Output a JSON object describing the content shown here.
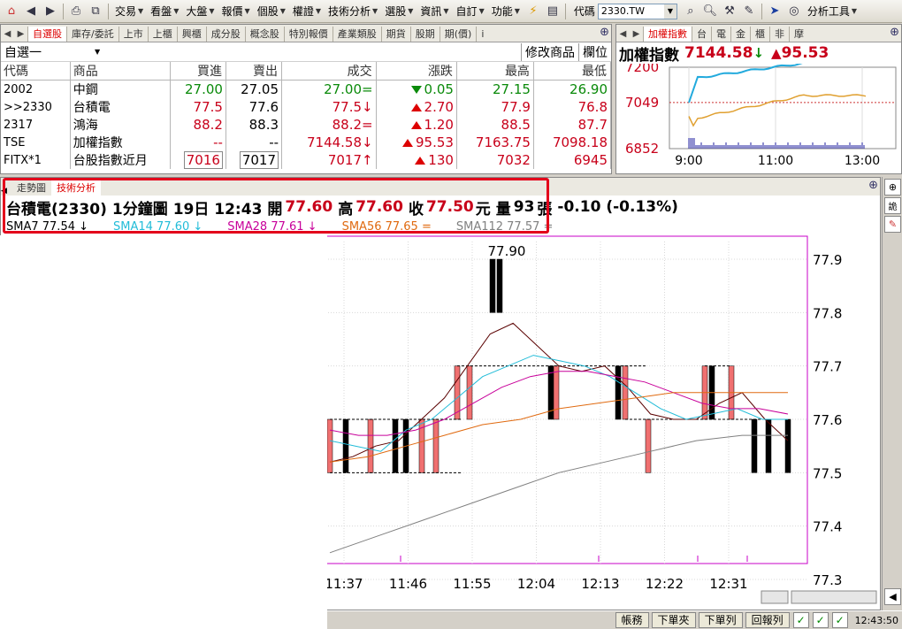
{
  "toolbar": {
    "menus": [
      "交易",
      "看盤",
      "大盤",
      "報價",
      "個股",
      "權證",
      "技術分析",
      "選股",
      "資訊",
      "自訂",
      "功能"
    ],
    "code_label": "代碼",
    "code_value": "2330.TW",
    "tools_label": "分析工具"
  },
  "quote_panel": {
    "tabs": [
      "自選股",
      "庫存/委託",
      "上市",
      "上櫃",
      "興櫃",
      "成分股",
      "概念股",
      "特別報價",
      "產業類股",
      "期貨",
      "股期",
      "期(價)",
      "i"
    ],
    "active_tab": 0,
    "list_name": "自選一",
    "edit_label": "修改商品",
    "columns_label": "欄位",
    "headers": [
      "代碼",
      "商品",
      "買進",
      "賣出",
      "成交",
      "漲跌",
      "最高",
      "最低"
    ],
    "rows": [
      {
        "code": "2002",
        "name": "中鋼",
        "bid": "27.00",
        "ask": "27.05",
        "last": "27.00=",
        "change": "0.05",
        "dir": "down",
        "high": "27.15",
        "low": "26.90",
        "color": "green"
      },
      {
        "code": ">>2330",
        "name": "台積電",
        "bid": "77.5",
        "ask": "77.6",
        "last": "77.5↓",
        "change": "2.70",
        "dir": "up",
        "high": "77.9",
        "low": "76.8",
        "color": "red"
      },
      {
        "code": "2317",
        "name": "鴻海",
        "bid": "88.2",
        "ask": "88.3",
        "last": "88.2=",
        "change": "1.20",
        "dir": "up",
        "high": "88.5",
        "low": "87.7",
        "color": "red"
      },
      {
        "code": "TSE",
        "name": "加權指數",
        "bid": "--",
        "ask": "--",
        "last": "7144.58↓",
        "change": "95.53",
        "dir": "up",
        "high": "7163.75",
        "low": "7098.18",
        "color": "red"
      },
      {
        "code": "FITX*1",
        "name": "台股指數近月",
        "bid": "7016",
        "ask": "7017",
        "last": "7017↑",
        "change": "130",
        "dir": "up",
        "high": "7032",
        "low": "6945",
        "color": "red"
      }
    ]
  },
  "index_panel": {
    "tabs": [
      "加權指數",
      "台",
      "電",
      "金",
      "櫃",
      "非",
      "摩"
    ],
    "name": "加權指數",
    "value": "7144.58",
    "arrow": "↓",
    "change": "95.53",
    "chart_data": {
      "type": "line",
      "x_ticks": [
        "9:00",
        "11:00",
        "13:00"
      ],
      "y_ticks": [
        7200,
        7049,
        6852
      ],
      "ylim": [
        6852,
        7200
      ]
    }
  },
  "chart_panel": {
    "tabs": [
      "走勢圖",
      "技術分析"
    ],
    "active_tab": 1,
    "info": {
      "stock": "台積電(2330)",
      "period": "1分鐘圖",
      "date_time": "19日 12:43",
      "open_label": "開",
      "open": "77.60",
      "high_label": "高",
      "high": "77.60",
      "close_label": "收",
      "close": "77.50",
      "unit": "元",
      "vol_label": "量",
      "volume": "93",
      "vol_unit": "張",
      "change": "-0.10 (-0.13%)"
    },
    "sma": [
      {
        "label": "SMA7 77.54",
        "arrow": "↓",
        "color": "#000000"
      },
      {
        "label": "SMA14 77.60",
        "arrow": "↓",
        "color": "#22bcd8"
      },
      {
        "label": "SMA28 77.61",
        "arrow": "↓",
        "color": "#c8009a"
      },
      {
        "label": "SMA56 77.65",
        "arrow": "=",
        "color": "#e06a10"
      },
      {
        "label": "SMA112 77.57",
        "arrow": "=",
        "color": "#808080"
      }
    ],
    "peak_label": "77.90"
  },
  "chart_data": {
    "type": "line",
    "title": "",
    "xlabel": "",
    "ylabel": "",
    "ylim": [
      77.3,
      77.9
    ],
    "y_ticks": [
      "77.9",
      "77.8",
      "77.7",
      "77.6",
      "77.5",
      "77.4",
      "77.3"
    ],
    "x_ticks": [
      "11:37",
      "11:46",
      "11:55",
      "12:04",
      "12:13",
      "12:22",
      "12:31"
    ],
    "series": [
      {
        "name": "SMA7",
        "color": "#5a0000",
        "values": [
          77.52,
          77.53,
          77.55,
          77.56,
          77.6,
          77.64,
          77.7,
          77.76,
          77.78,
          77.74,
          77.7,
          77.69,
          77.7,
          77.66,
          77.61,
          77.6,
          77.6,
          77.63,
          77.65,
          77.6,
          77.56
        ]
      },
      {
        "name": "SMA14",
        "color": "#22bcd8",
        "values": [
          77.56,
          77.55,
          77.54,
          77.58,
          77.6,
          77.64,
          77.68,
          77.7,
          77.72,
          77.71,
          77.7,
          77.68,
          77.65,
          77.62,
          77.6,
          77.61,
          77.62,
          77.6,
          77.6
        ]
      },
      {
        "name": "SMA28",
        "color": "#c8009a",
        "values": [
          77.58,
          77.57,
          77.57,
          77.58,
          77.6,
          77.63,
          77.66,
          77.68,
          77.69,
          77.69,
          77.68,
          77.67,
          77.65,
          77.63,
          77.62,
          77.62,
          77.61
        ]
      },
      {
        "name": "SMA56",
        "color": "#e06a10",
        "values": [
          77.52,
          77.53,
          77.55,
          77.57,
          77.59,
          77.6,
          77.62,
          77.63,
          77.64,
          77.65,
          77.65,
          77.65,
          77.65
        ]
      },
      {
        "name": "SMA112",
        "color": "#808080",
        "values": [
          77.35,
          77.38,
          77.41,
          77.44,
          77.47,
          77.5,
          77.52,
          77.54,
          77.56,
          77.57,
          77.57
        ]
      }
    ]
  },
  "status_bar": {
    "buttons": [
      "帳務",
      "下單夾",
      "下單列",
      "回報列"
    ],
    "time": "12:43:50"
  }
}
